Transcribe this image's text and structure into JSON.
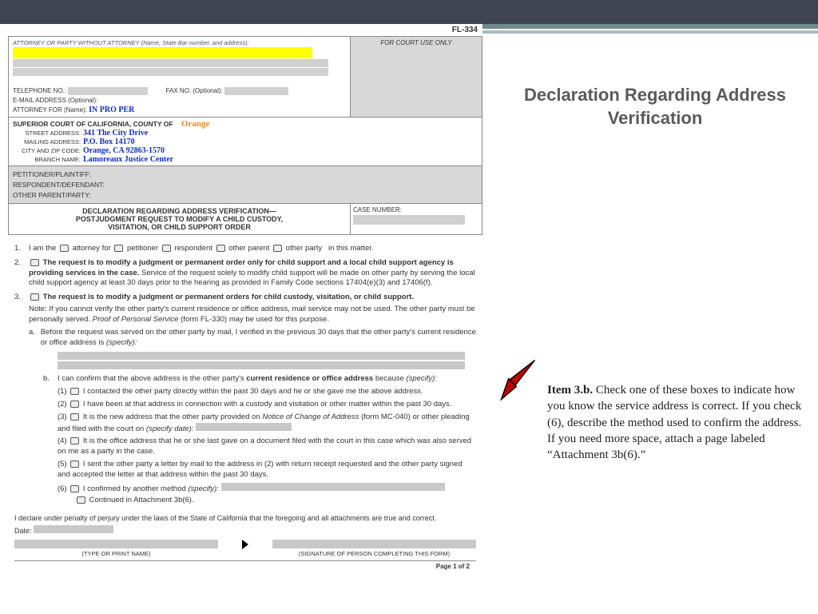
{
  "form_id": "FL-334",
  "court_use": "FOR COURT USE ONLY",
  "atty_header": "ATTORNEY OR PARTY WITHOUT ATTORNEY (Name, State Bar number, and address):",
  "tel": "TELEPHONE NO.:",
  "fax": "FAX NO. (Optional):",
  "email": "E-MAIL ADDRESS (Optional):",
  "atty_for": "ATTORNEY FOR (Name):",
  "atty_for_val": "IN PRO PER",
  "court_line": "SUPERIOR COURT OF CALIFORNIA, COUNTY OF",
  "county": "Orange",
  "street_lbl": "STREET ADDRESS:",
  "street_val": "341 The City Drive",
  "mail_lbl": "MAILING ADDRESS:",
  "mail_val": "P.O. Box 14170",
  "city_lbl": "CITY AND ZIP CODE:",
  "city_val": "Orange, CA 92863-1570",
  "branch_lbl": "BRANCH NAME:",
  "branch_val": "Lamoreaux Justice Center",
  "pet": "PETITIONER/PLAINTIFF:",
  "res": "RESPONDENT/DEFENDANT:",
  "oth": "OTHER PARENT/PARTY:",
  "doc_title1": "DECLARATION REGARDING ADDRESS VERIFICATION—",
  "doc_title2": "POSTJUDGMENT REQUEST TO MODIFY A CHILD CUSTODY,",
  "doc_title3": "VISITATION, OR CHILD SUPPORT ORDER",
  "case_lbl": "CASE NUMBER:",
  "item1_pre": "I am the",
  "roles": {
    "a": "attorney for",
    "b": "petitioner",
    "c": "respondent",
    "d": "other parent",
    "e": "other party"
  },
  "item1_suf": "in this matter.",
  "item2": "The request is to modify a judgment or permanent order only for child support and a local child support agency is providing services in the case.",
  "item2_tail": " Service of the request solely to modify child support will be made on other party by serving the local child support agency at least 30 days prior to the hearing as provided in Family Code sections 17404(e)(3) and 17406(f).",
  "item3_head": "The request is to modify a judgment or permanent orders for child custody, visitation, or child support.",
  "item3_note": "Note: If you cannot verify the other party's current residence or office address, mail service may not be used. The other party must be personally served. ",
  "item3_note_ital": "Proof of Personal Service",
  "item3_note_tail": " (form FL-330) may be used for this purpose.",
  "item3a": "Before the request was served on the other party by mail, I verified in the previous 30 days that the other party's current residence or office address is ",
  "specify": "(specify):",
  "item3b_pre": "I can confirm that the above address is the other party's ",
  "item3b_bold": "current residence or office address",
  "item3b_tail": " because ",
  "b1": "I contacted the other party directly within the past 30 days and he or she gave me the above address.",
  "b2": "I have been at that address in connection with a custody and visitation or other matter within the past 30 days.",
  "b3_pre": "It is the new address that the other party provided on ",
  "b3_ital": "Notice of Change of Address",
  "b3_mid": " (form MC-040) or other pleading and filed with the court on ",
  "b3_spec": "(specify date):",
  "b4": "It is the office address that he or she last gave on a document filed with the court in this case which was also served on me as a party in the case.",
  "b5": "I sent the other party a letter by mail to the address in (2) with return receipt requested and the other party signed and accepted the letter at that address within the past 30 days.",
  "b6_pre": "I confirmed by another method ",
  "b6_cont": "Continued in Attachment 3b(6).",
  "perjury": "I declare under penalty of perjury under the laws of the State of California that the foregoing and all attachments are true and correct.",
  "date_lbl": "Date:",
  "sig1": "(TYPE OR PRINT NAME)",
  "sig2": "(SIGNATURE OF PERSON COMPLETING THIS FORM)",
  "page_foot": "Page 1 of 2",
  "slide_title": "Declaration Regarding Address Verification",
  "note_bold": "Item 3.b.",
  "note_body": "  Check one of these boxes to indicate how you know the service address is correct.  If you check (6), describe the method used to confirm the address.  If you need more space, attach a page labeled “Attachment 3b(6).”"
}
